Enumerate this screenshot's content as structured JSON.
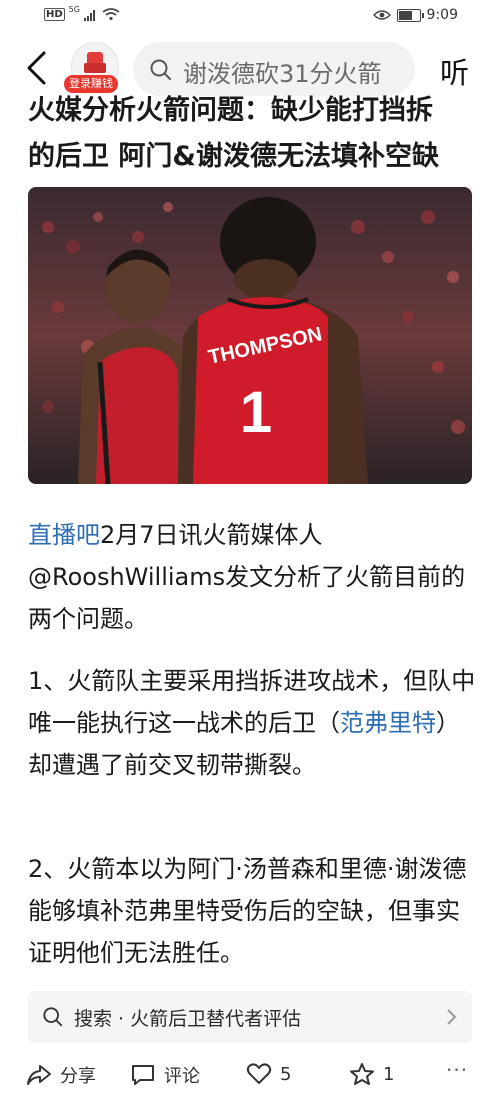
{
  "status_bar": {
    "network": "HD",
    "signal": "5G",
    "time": "9:09"
  },
  "nav": {
    "login_badge": "登录赚钱",
    "search_text": "谢泼德砍31分火箭",
    "listen_label": "听"
  },
  "article": {
    "title_line1": "火媒分析火箭问题：缺少能打挡拆",
    "title_line2": "的后卫 阿门&谢泼德无法填补空缺",
    "jersey_name": "THOMPSON",
    "jersey_number": "1",
    "p1_source": "直播吧",
    "p1_text": "2月7日讯火箭媒体人@RooshWilliams发文分析了火箭目前的两个问题。",
    "p2_before": "1、火箭队主要采用挡拆进攻战术，但队中唯一能执行这一战术的后卫（",
    "p2_link": "范弗里特",
    "p2_after": "）却遭遇了前交叉韧带撕裂。",
    "p3_text": "2、火箭本以为阿门·汤普森和里德·谢泼德能够填补范弗里特受伤后的空缺，但事实证明他们无法胜任。"
  },
  "related_search": {
    "text": "搜索 · 火箭后卫替代者评估"
  },
  "bottom_bar": {
    "share_label": "分享",
    "comment_label": "评论",
    "like_count": "5",
    "fav_count": "1",
    "more_label": "···"
  },
  "colors": {
    "accent_link": "#2e6fb3",
    "badge_red": "#e7372f",
    "jersey_red": "#d01c2a"
  }
}
